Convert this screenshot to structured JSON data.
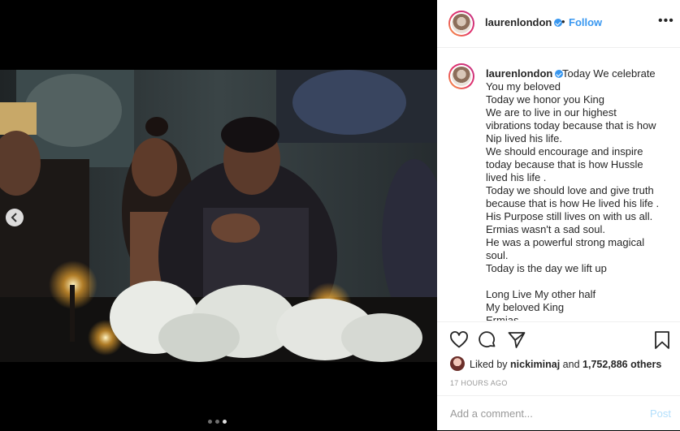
{
  "post": {
    "username": "laurenlondon",
    "follow_label": "Follow",
    "separator": "•",
    "more_label": "•••"
  },
  "caption": {
    "username": "laurenlondon",
    "first_line": "Today We celebrate",
    "lines": [
      "You my beloved",
      "Today we honor you King",
      "We are to live in our highest",
      "vibrations today because that is how",
      "Nip lived his life.",
      "We should encourage and inspire",
      "today because that is how Hussle",
      "lived his life .",
      "Today we should love and give truth",
      "because that is how He lived his life .",
      "His Purpose still lives on with us all.",
      "Ermias wasn't a sad soul.",
      "He was a powerful strong magical",
      "soul.",
      "Today is the day we lift up",
      "",
      "Long Live My other half",
      "My beloved King",
      "Ermias"
    ]
  },
  "likes": {
    "prefix": "Liked by",
    "user": "nickiminaj",
    "connector": "and",
    "count": "1,752,886 others"
  },
  "timestamp": "17 HOURS AGO",
  "comment": {
    "placeholder": "Add a comment...",
    "post_label": "Post"
  },
  "carousel": {
    "total": 3,
    "active_index": 2
  },
  "icons": {
    "heart": "heart-icon",
    "comment": "comment-icon",
    "share": "share-icon",
    "save": "bookmark-icon",
    "prev": "chevron-left-icon",
    "verified": "verified-badge-icon"
  },
  "colors": {
    "link_blue": "#3897f0",
    "post_disabled": "#b2dffc",
    "text": "#262626",
    "muted": "#999999"
  }
}
